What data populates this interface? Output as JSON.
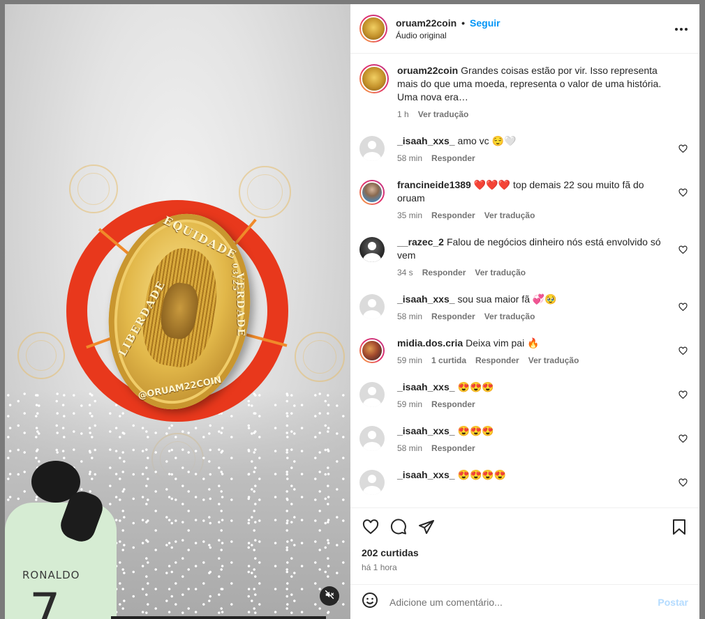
{
  "header": {
    "username": "oruam22coin",
    "separator": "•",
    "follow_label": "Seguir",
    "audio_label": "Áudio original"
  },
  "media": {
    "coin_top_text": "EQUIDADE",
    "coin_left_text": "LIBERDADE",
    "coin_right_text": "VERDADE",
    "coin_date": "03/25",
    "coin_handle": "@ORUAM22COIN",
    "shirt_name": "RONALDO",
    "shirt_number": "7",
    "muted": true
  },
  "caption": {
    "username": "oruam22coin",
    "text": "Grandes coisas estão por vir. Isso representa mais do que uma moeda, representa o valor de uma história. Uma nova era…",
    "time": "1 h",
    "translate": "Ver tradução"
  },
  "comments": [
    {
      "username": "_isaah_xxs_",
      "text": "amo vc 😌🤍",
      "time": "58 min",
      "reply": "Responder",
      "translate": "",
      "likes": ""
    },
    {
      "username": "francineide1389",
      "text": "❤️❤️❤️ top demais 22 sou muito fã do oruam",
      "time": "35 min",
      "reply": "Responder",
      "translate": "Ver tradução",
      "likes": ""
    },
    {
      "username": "__razec_2",
      "text": "Falou de negócios dinheiro nós está envolvido só vem",
      "time": "34 s",
      "reply": "Responder",
      "translate": "Ver tradução",
      "likes": ""
    },
    {
      "username": "_isaah_xxs_",
      "text": "sou sua maior fã 💞🥹",
      "time": "58 min",
      "reply": "Responder",
      "translate": "Ver tradução",
      "likes": ""
    },
    {
      "username": "midia.dos.cria",
      "text": "Deixa vim pai 🔥",
      "time": "59 min",
      "reply": "Responder",
      "translate": "Ver tradução",
      "likes": "1 curtida"
    },
    {
      "username": "_isaah_xxs_",
      "text": "😍😍😍",
      "time": "59 min",
      "reply": "Responder",
      "translate": "",
      "likes": ""
    },
    {
      "username": "_isaah_xxs_",
      "text": "😍😍😍",
      "time": "58 min",
      "reply": "Responder",
      "translate": "",
      "likes": ""
    },
    {
      "username": "_isaah_xxs_",
      "text": "😍😍😍😍",
      "time": "",
      "reply": "",
      "translate": "",
      "likes": ""
    }
  ],
  "footer": {
    "likes_count": "202 curtidas",
    "posted_ago": "há 1 hora",
    "comment_placeholder": "Adicione um comentário...",
    "post_label": "Postar"
  },
  "colors": {
    "accent": "#0095f6",
    "ring": "#e8381c",
    "post_disabled": "#b3dbff"
  }
}
